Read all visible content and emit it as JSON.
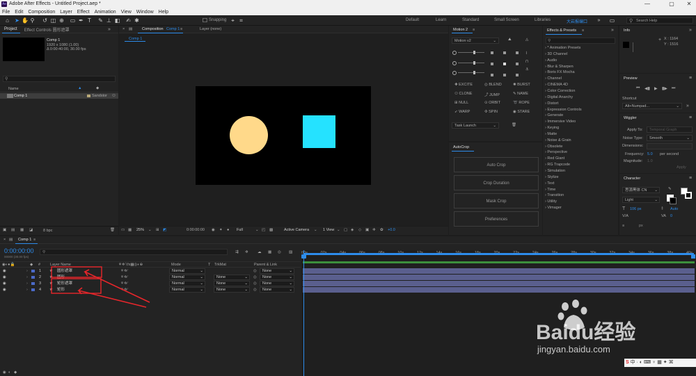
{
  "app": {
    "title": "Adobe After Effects - Untitled Project.aep *",
    "logo": "Ae",
    "window_controls": [
      "—",
      "▢",
      "✕"
    ]
  },
  "menu": [
    "File",
    "Edit",
    "Composition",
    "Layer",
    "Effect",
    "Animation",
    "View",
    "Window",
    "Help"
  ],
  "toolbar": {
    "snapping_label": "Snapping",
    "workspaces": [
      "Default",
      "Learn",
      "Standard",
      "Small Screen",
      "Libraries",
      "大岩报编口"
    ],
    "active_workspace": 5,
    "search_placeholder": "Search Help"
  },
  "project_panel": {
    "tabs": [
      "Project",
      "Effect Controls 圆形遮罩"
    ],
    "comp_name": "Comp 1",
    "comp_info_1": "1920 x 1080 (1.00)",
    "comp_info_2": "Δ 0:00:40:00, 30.00 fps",
    "col_name": "Name",
    "item_name": "Comp 1",
    "item_type": "Sandstor",
    "bpc": "8 bpc"
  },
  "composition_panel": {
    "tab_label": "Composition",
    "tab_comp": "Comp 1",
    "layer_tab": "Layer (none)",
    "breadcrumb": "Comp 1",
    "zoom": "25%",
    "timecode": "0:00:00:00",
    "resolution": "Full",
    "camera": "Active Camera",
    "view": "1 View",
    "offset": "+0.0",
    "circle_color": "#ffd98a",
    "square_color": "#25e2ff"
  },
  "motion_panel": {
    "title": "Motion 2",
    "preset": "Motion v2",
    "buttons": [
      [
        "EXCITE",
        "BLEND",
        "BURST"
      ],
      [
        "CLONE",
        "JUMP",
        "NAME"
      ],
      [
        "NULL",
        "ORBIT",
        "ROPE"
      ],
      [
        "WARP",
        "SPIN",
        "STARE"
      ]
    ],
    "task": "Task Launch"
  },
  "autocrop_panel": {
    "title": "AutoCrop",
    "buttons": [
      "Auto Crop",
      "Crop Duration",
      "Mask Crop",
      "Preferences"
    ]
  },
  "effects_panel": {
    "title": "Effects & Presets",
    "items": [
      "* Animation Presets",
      "3D Channel",
      "Audio",
      "Blur & Sharpen",
      "Boris FX Mocha",
      "Channel",
      "CINEMA 4D",
      "Color Correction",
      "Digital Anarchy",
      "Distort",
      "Expression Controls",
      "Generate",
      "Immersive Video",
      "Keying",
      "Matte",
      "Noise & Grain",
      "Obsolete",
      "Perspective",
      "Red Giant",
      "RG Trapcode",
      "Simulation",
      "Stylize",
      "Text",
      "Time",
      "Transition",
      "Utility",
      "Vimager"
    ]
  },
  "info_panel": {
    "title": "Info",
    "x": "X : 1164",
    "y": "Y : 1516"
  },
  "preview_panel": {
    "title": "Preview",
    "shortcut_label": "Shortcut",
    "shortcut_value": "Alt+Numpad..."
  },
  "wiggler_panel": {
    "title": "Wiggler",
    "apply_to": "Apply To:",
    "apply_value": "Temporal Graph",
    "noise_type": "Noise Type:",
    "noise_value": "Smooth",
    "dimensions": "Dimensions:",
    "frequency": "Frequency:",
    "frequency_value": "5.0",
    "per_second": "per second",
    "magnitude": "Magnitude:",
    "magnitude_value": "1.0",
    "apply_btn": "Apply"
  },
  "character_panel": {
    "title": "Character",
    "font": "思源黑体 CN",
    "style": "Light",
    "size": "106 px",
    "leading": "Auto",
    "tracking": "0",
    "unit": "px"
  },
  "timeline": {
    "tab": "Comp 1",
    "timecode": "0:00:00:00",
    "columns": {
      "layer_name": "Layer Name",
      "mode": "Mode",
      "t": "T",
      "trkmat": "TrkMat",
      "parent": "Parent & Link"
    },
    "layers": [
      {
        "num": "1",
        "name": "圆形遮罩",
        "mode": "Normal",
        "trkmat": "",
        "parent": "None",
        "color": "#4b6ac8"
      },
      {
        "num": "2",
        "name": "圆形",
        "mode": "Normal",
        "trkmat": "None",
        "parent": "None",
        "color": "#4b6ac8"
      },
      {
        "num": "3",
        "name": "矩形遮罩",
        "mode": "Normal",
        "trkmat": "None",
        "parent": "None",
        "color": "#4b6ac8"
      },
      {
        "num": "4",
        "name": "矩形",
        "mode": "Normal",
        "trkmat": "None",
        "parent": "None",
        "color": "#4b6ac8"
      }
    ],
    "ruler": [
      "00s",
      "02s",
      "04s",
      "06s",
      "08s",
      "10s",
      "12s",
      "14s",
      "16s",
      "18s",
      "20s",
      "22s",
      "24s",
      "26s",
      "28s",
      "30s",
      "32s",
      "34s",
      "36s",
      "38s",
      "40s"
    ]
  },
  "watermark": {
    "logo": "Baidu经验",
    "url": "jingyan.baidu.com"
  }
}
